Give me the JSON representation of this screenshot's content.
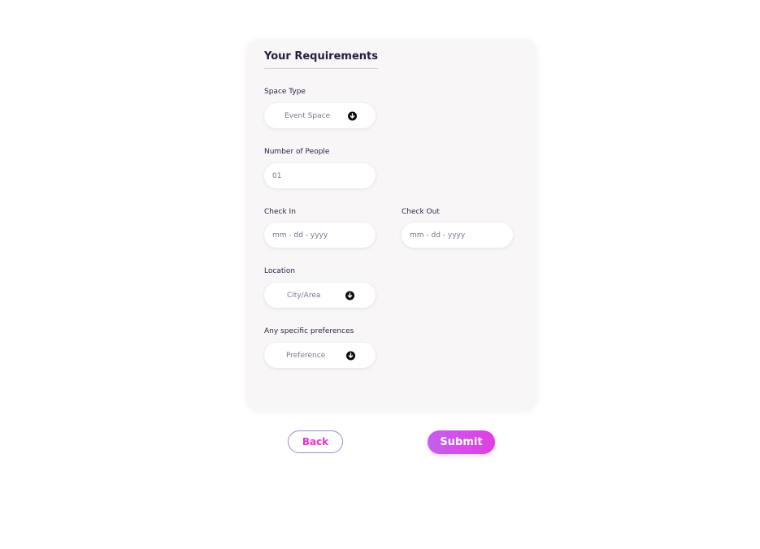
{
  "form": {
    "title": "Your Requirements",
    "space_type": {
      "label": "Space Type",
      "value": "Event Space",
      "icon": "arrow-down-circle-icon"
    },
    "people": {
      "label": "Number of People",
      "value": "01"
    },
    "check_in": {
      "label": "Check In",
      "placeholder": "mm - dd - yyyy"
    },
    "check_out": {
      "label": "Check Out",
      "placeholder": "mm - dd - yyyy"
    },
    "location": {
      "label": "Location",
      "value": "City/Area",
      "icon": "arrow-down-circle-icon"
    },
    "preferences": {
      "label": "Any specific preferences",
      "value": "Preference",
      "icon": "arrow-down-circle-icon"
    }
  },
  "actions": {
    "back_label": "Back",
    "submit_label": "Submit"
  },
  "colors": {
    "accent": "#e436c8",
    "submit_gradient_start": "#c560ee",
    "submit_gradient_end": "#e03ee0",
    "card_background": "#f8f6f7",
    "title_text": "#231f3d"
  }
}
